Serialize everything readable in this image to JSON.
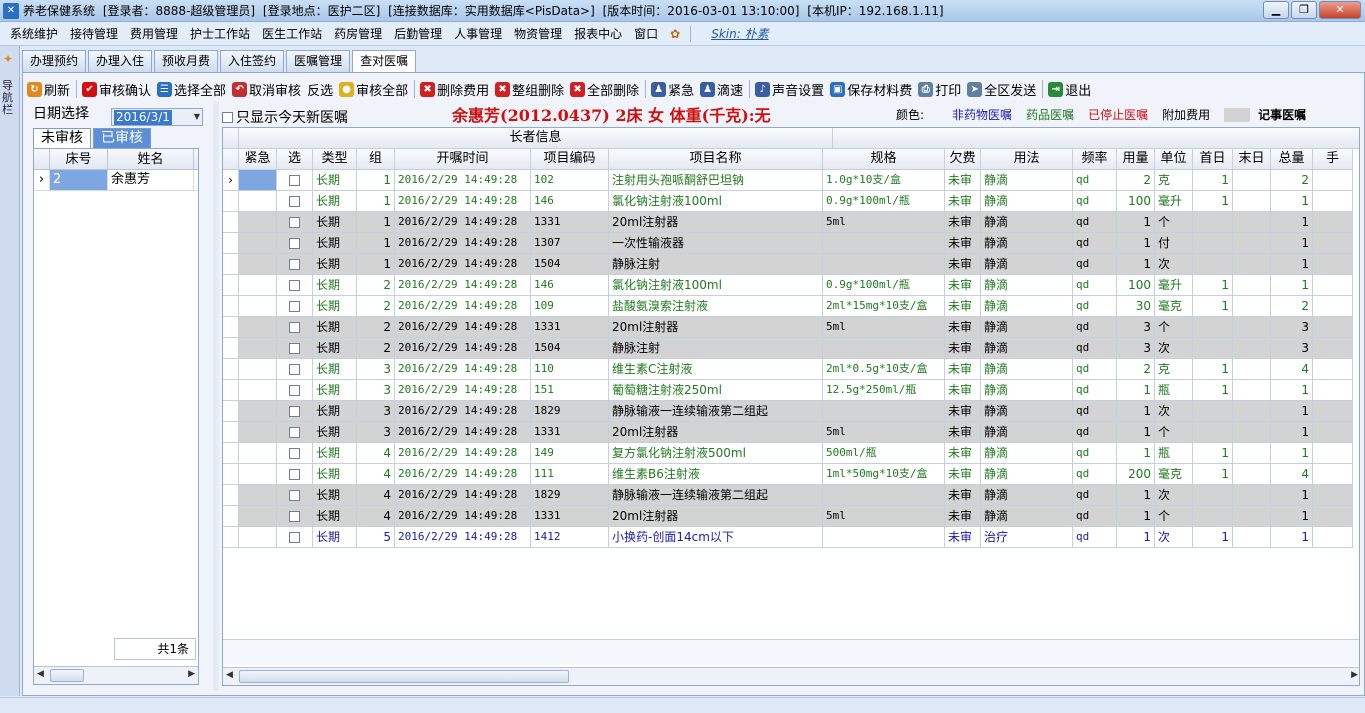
{
  "app": {
    "title": "养老保健系统",
    "login_user": "[登录者：8888-超级管理员]",
    "login_location": "[登录地点：医护二区]",
    "database": "[连接数据库：实用数据库<PisData>]",
    "version": "[版本时间：2016-03-01 13:10:00]",
    "ip": "[本机IP：192.168.1.11]"
  },
  "menu": [
    "系统维护",
    "接待管理",
    "费用管理",
    "护士工作站",
    "医生工作站",
    "药房管理",
    "后勤管理",
    "人事管理",
    "物资管理",
    "报表中心",
    "窗口"
  ],
  "skin": "Skin: 朴素",
  "leftbar_text": "导航栏",
  "tabs": [
    "办理预约",
    "办理入住",
    "预收月费",
    "入住签约",
    "医嘱管理",
    "查对医嘱"
  ],
  "toolbar": [
    {
      "label": "刷新",
      "icon": "refresh-icon",
      "color": "#e08a1e",
      "glyph": "↻"
    },
    {
      "label": "审核确认",
      "icon": "check-icon",
      "color": "#d01010",
      "glyph": "✔"
    },
    {
      "label": "选择全部",
      "icon": "select-all-icon",
      "color": "#2a6fc0",
      "glyph": "☰"
    },
    {
      "label": "取消审核",
      "icon": "cancel-audit-icon",
      "color": "#c03030",
      "glyph": "↶"
    },
    {
      "label": "反选",
      "icon": "",
      "color": "",
      "glyph": ""
    },
    {
      "label": "审核全部",
      "icon": "bulb-icon",
      "color": "#e0b020",
      "glyph": "●"
    },
    {
      "label": "删除费用",
      "icon": "delete-fee-icon",
      "color": "#d02020",
      "glyph": "✖"
    },
    {
      "label": "整组删除",
      "icon": "delete-group-icon",
      "color": "#d02020",
      "glyph": "✖"
    },
    {
      "label": "全部删除",
      "icon": "delete-all-icon",
      "color": "#d02020",
      "glyph": "✖"
    },
    {
      "label": "紧急",
      "icon": "urgent-icon",
      "color": "#3a5fa0",
      "glyph": "♟"
    },
    {
      "label": "滴速",
      "icon": "drip-icon",
      "color": "#3a5fa0",
      "glyph": "♟"
    },
    {
      "label": "声音设置",
      "icon": "sound-icon",
      "color": "#3a5fa0",
      "glyph": "♪"
    },
    {
      "label": "保存材料费",
      "icon": "save-icon",
      "color": "#2a6fc0",
      "glyph": "▣"
    },
    {
      "label": "打印",
      "icon": "print-icon",
      "color": "#6080a0",
      "glyph": "⎙"
    },
    {
      "label": "全区发送",
      "icon": "send-icon",
      "color": "#6080a0",
      "glyph": "➤"
    },
    {
      "label": "退出",
      "icon": "exit-icon",
      "color": "#2a8a3a",
      "glyph": "⇥"
    }
  ],
  "left": {
    "date_label": "日期选择",
    "date_value": "2016/3/1",
    "tab_unaudited": "未审核",
    "tab_audited": "已审核",
    "headers": [
      "床号",
      "姓名"
    ],
    "rows": [
      {
        "bed": "2",
        "name": "余惠芳"
      }
    ],
    "total": "共1条"
  },
  "right": {
    "show_today_label": "只显示今天新医嘱",
    "patient_info": "余惠芳(2012.0437) 2床 女 体重(千克):无",
    "legend_label": "颜色:",
    "legend_items": [
      {
        "label": "非药物医嘱",
        "color": "#1a1ab0"
      },
      {
        "label": "药品医嘱",
        "color": "#1f7a1f"
      },
      {
        "label": "已停止医嘱",
        "color": "#d01010"
      },
      {
        "label": "附加费用",
        "color": "#000000"
      },
      {
        "label": "记事医嘱",
        "color": "#000000"
      }
    ],
    "group_header": "长者信息",
    "columns": [
      "紧急",
      "选",
      "类型",
      "组",
      "开嘱时间",
      "项目编码",
      "项目名称",
      "规格",
      "欠费",
      "用法",
      "频率",
      "用量",
      "单位",
      "首日",
      "末日",
      "总量",
      "手"
    ],
    "rows": [
      {
        "style": "green",
        "type": "长期",
        "group": "1",
        "time": "2016/2/29 14:49:28",
        "code": "102",
        "name": "注射用头孢哌酮舒巴坦钠",
        "spec": "1.0g*10支/盒",
        "fee": "未审",
        "usage": "静滴",
        "freq": "qd",
        "qty": "2",
        "unit": "克",
        "first": "1",
        "last": "",
        "total": "2"
      },
      {
        "style": "green",
        "type": "长期",
        "group": "1",
        "time": "2016/2/29 14:49:28",
        "code": "146",
        "name": "氯化钠注射液100ml",
        "spec": "0.9g*100ml/瓶",
        "fee": "未审",
        "usage": "静滴",
        "freq": "qd",
        "qty": "100",
        "unit": "毫升",
        "first": "1",
        "last": "",
        "total": "1"
      },
      {
        "style": "gray",
        "type": "长期",
        "group": "1",
        "time": "2016/2/29 14:49:28",
        "code": "1331",
        "name": "20ml注射器",
        "spec": "5ml",
        "fee": "未审",
        "usage": "静滴",
        "freq": "qd",
        "qty": "1",
        "unit": "个",
        "first": "",
        "last": "",
        "total": "1"
      },
      {
        "style": "gray",
        "type": "长期",
        "group": "1",
        "time": "2016/2/29 14:49:28",
        "code": "1307",
        "name": "一次性输液器",
        "spec": "",
        "fee": "未审",
        "usage": "静滴",
        "freq": "qd",
        "qty": "1",
        "unit": "付",
        "first": "",
        "last": "",
        "total": "1"
      },
      {
        "style": "gray",
        "type": "长期",
        "group": "1",
        "time": "2016/2/29 14:49:28",
        "code": "1504",
        "name": "静脉注射",
        "spec": "",
        "fee": "未审",
        "usage": "静滴",
        "freq": "qd",
        "qty": "1",
        "unit": "次",
        "first": "",
        "last": "",
        "total": "1"
      },
      {
        "style": "green",
        "type": "长期",
        "group": "2",
        "time": "2016/2/29 14:49:28",
        "code": "146",
        "name": "氯化钠注射液100ml",
        "spec": "0.9g*100ml/瓶",
        "fee": "未审",
        "usage": "静滴",
        "freq": "qd",
        "qty": "100",
        "unit": "毫升",
        "first": "1",
        "last": "",
        "total": "1"
      },
      {
        "style": "green",
        "type": "长期",
        "group": "2",
        "time": "2016/2/29 14:49:28",
        "code": "109",
        "name": "盐酸氨溴索注射液",
        "spec": "2ml*15mg*10支/盒",
        "fee": "未审",
        "usage": "静滴",
        "freq": "qd",
        "qty": "30",
        "unit": "毫克",
        "first": "1",
        "last": "",
        "total": "2"
      },
      {
        "style": "gray",
        "type": "长期",
        "group": "2",
        "time": "2016/2/29 14:49:28",
        "code": "1331",
        "name": "20ml注射器",
        "spec": "5ml",
        "fee": "未审",
        "usage": "静滴",
        "freq": "qd",
        "qty": "3",
        "unit": "个",
        "first": "",
        "last": "",
        "total": "3"
      },
      {
        "style": "gray",
        "type": "长期",
        "group": "2",
        "time": "2016/2/29 14:49:28",
        "code": "1504",
        "name": "静脉注射",
        "spec": "",
        "fee": "未审",
        "usage": "静滴",
        "freq": "qd",
        "qty": "3",
        "unit": "次",
        "first": "",
        "last": "",
        "total": "3"
      },
      {
        "style": "green",
        "type": "长期",
        "group": "3",
        "time": "2016/2/29 14:49:28",
        "code": "110",
        "name": "维生素C注射液",
        "spec": "2ml*0.5g*10支/盒",
        "fee": "未审",
        "usage": "静滴",
        "freq": "qd",
        "qty": "2",
        "unit": "克",
        "first": "1",
        "last": "",
        "total": "4"
      },
      {
        "style": "green",
        "type": "长期",
        "group": "3",
        "time": "2016/2/29 14:49:28",
        "code": "151",
        "name": "葡萄糖注射液250ml",
        "spec": "12.5g*250ml/瓶",
        "fee": "未审",
        "usage": "静滴",
        "freq": "qd",
        "qty": "1",
        "unit": "瓶",
        "first": "1",
        "last": "",
        "total": "1"
      },
      {
        "style": "gray",
        "type": "长期",
        "group": "3",
        "time": "2016/2/29 14:49:28",
        "code": "1829",
        "name": "静脉输液一连续输液第二组起",
        "spec": "",
        "fee": "未审",
        "usage": "静滴",
        "freq": "qd",
        "qty": "1",
        "unit": "次",
        "first": "",
        "last": "",
        "total": "1"
      },
      {
        "style": "gray",
        "type": "长期",
        "group": "3",
        "time": "2016/2/29 14:49:28",
        "code": "1331",
        "name": "20ml注射器",
        "spec": "5ml",
        "fee": "未审",
        "usage": "静滴",
        "freq": "qd",
        "qty": "1",
        "unit": "个",
        "first": "",
        "last": "",
        "total": "1"
      },
      {
        "style": "green",
        "type": "长期",
        "group": "4",
        "time": "2016/2/29 14:49:28",
        "code": "149",
        "name": "复方氯化钠注射液500ml",
        "spec": "500ml/瓶",
        "fee": "未审",
        "usage": "静滴",
        "freq": "qd",
        "qty": "1",
        "unit": "瓶",
        "first": "1",
        "last": "",
        "total": "1"
      },
      {
        "style": "green",
        "type": "长期",
        "group": "4",
        "time": "2016/2/29 14:49:28",
        "code": "111",
        "name": "维生素B6注射液",
        "spec": "1ml*50mg*10支/盒",
        "fee": "未审",
        "usage": "静滴",
        "freq": "qd",
        "qty": "200",
        "unit": "毫克",
        "first": "1",
        "last": "",
        "total": "4"
      },
      {
        "style": "gray",
        "type": "长期",
        "group": "4",
        "time": "2016/2/29 14:49:28",
        "code": "1829",
        "name": "静脉输液一连续输液第二组起",
        "spec": "",
        "fee": "未审",
        "usage": "静滴",
        "freq": "qd",
        "qty": "1",
        "unit": "次",
        "first": "",
        "last": "",
        "total": "1"
      },
      {
        "style": "gray",
        "type": "长期",
        "group": "4",
        "time": "2016/2/29 14:49:28",
        "code": "1331",
        "name": "20ml注射器",
        "spec": "5ml",
        "fee": "未审",
        "usage": "静滴",
        "freq": "qd",
        "qty": "1",
        "unit": "个",
        "first": "",
        "last": "",
        "total": "1"
      },
      {
        "style": "blue",
        "type": "长期",
        "group": "5",
        "time": "2016/2/29 14:49:28",
        "code": "1412",
        "name": "小换药-创面14cm以下",
        "spec": "",
        "fee": "未审",
        "usage": "治疗",
        "freq": "qd",
        "qty": "1",
        "unit": "次",
        "first": "1",
        "last": "",
        "total": "1"
      }
    ]
  }
}
